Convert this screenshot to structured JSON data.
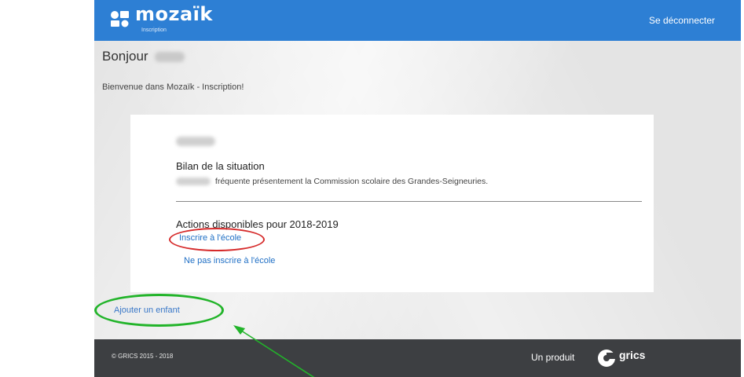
{
  "header": {
    "brand": "mozaïk",
    "brand_sub": "Inscription",
    "logout_label": "Se déconnecter"
  },
  "main": {
    "greeting": "Bonjour",
    "welcome": "Bienvenue dans Mozaïk - Inscription!",
    "card": {
      "status_title": "Bilan de la situation",
      "status_text": "fréquente présentement la Commission scolaire des Grandes-Seigneuries.",
      "actions_title": "Actions disponibles pour 2018-2019",
      "enroll_link": "Inscrire à l'école",
      "no_enroll_link": "Ne pas inscrire à l'école"
    },
    "add_child_link": "Ajouter un enfant"
  },
  "footer": {
    "copyright": "© GRICS 2015 - 2018",
    "product_label": "Un produit",
    "product_brand": "grics"
  },
  "colors": {
    "header_bg": "#2d7fd4",
    "link": "#1f6fc5",
    "footer_bg": "#3d3f42",
    "annotation_red": "#d62b2b",
    "annotation_green": "#22b42a"
  }
}
